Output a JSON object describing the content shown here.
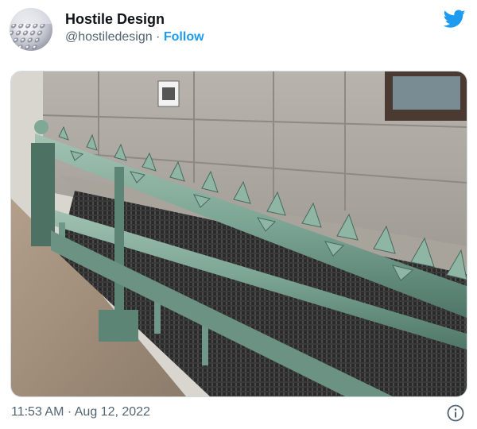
{
  "tweet": {
    "author_name": "Hostile Design",
    "handle": "@hostiledesign",
    "separator": "·",
    "follow_label": "Follow",
    "timestamp": "11:53 AM · Aug 12, 2022"
  },
  "icons": {
    "brand": "twitter-bird-icon",
    "info": "info-icon"
  },
  "colors": {
    "accent": "#1d9bf0",
    "muted": "#536471",
    "text": "#0f1419"
  }
}
